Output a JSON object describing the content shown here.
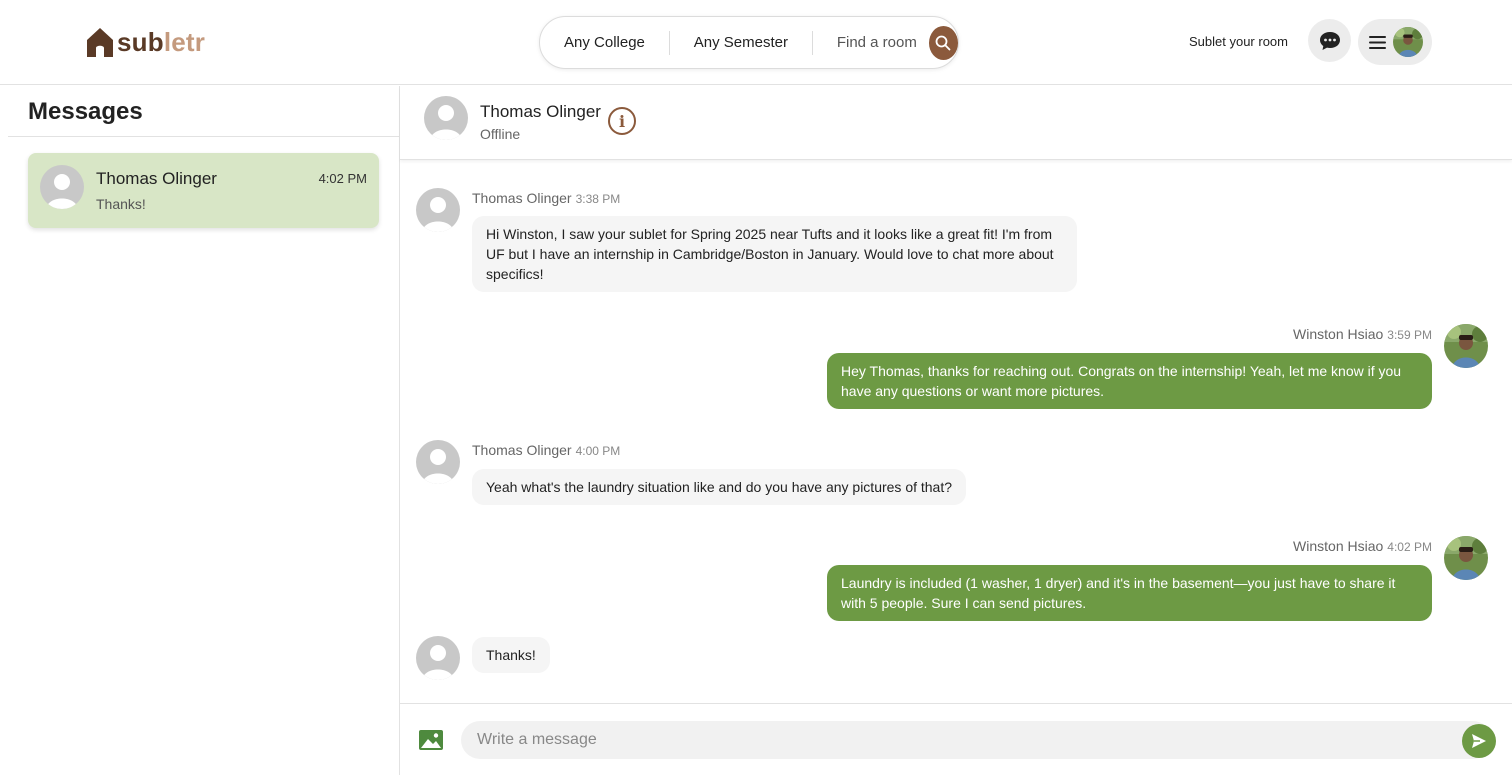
{
  "header": {
    "logo_sub": "sub",
    "logo_letr": "letr",
    "search": {
      "college": "Any College",
      "semester": "Any Semester",
      "find": "Find a room"
    },
    "sublet_link": "Sublet your room"
  },
  "sidebar": {
    "title": "Messages",
    "conversations": [
      {
        "name": "Thomas Olinger",
        "time": "4:02 PM",
        "preview": "Thanks!"
      }
    ]
  },
  "chat": {
    "contact_name": "Thomas Olinger",
    "contact_status": "Offline",
    "messages": [
      {
        "sender": "Thomas Olinger",
        "time": "3:38 PM",
        "direction": "in",
        "text": "Hi Winston, I saw your sublet for Spring 2025 near Tufts and it looks like a great fit! I'm from UF but I have an internship in Cambridge/Boston in January. Would love to chat more about specifics!"
      },
      {
        "sender": "Winston Hsiao",
        "time": "3:59 PM",
        "direction": "out",
        "text": "Hey Thomas, thanks for reaching out. Congrats on the internship! Yeah, let me know if you have any questions or want more pictures."
      },
      {
        "sender": "Thomas Olinger",
        "time": "4:00 PM",
        "direction": "in",
        "text": "Yeah what's the laundry situation like and do you have any pictures of that?"
      },
      {
        "sender": "Winston Hsiao",
        "time": "4:02 PM",
        "direction": "out",
        "text": "Laundry is included (1 washer, 1 dryer) and it's in the basement—you just have to share it with 5 people. Sure I can send pictures."
      },
      {
        "sender": "",
        "time": "",
        "direction": "in",
        "text": "Thanks!"
      }
    ],
    "composer_placeholder": "Write a message"
  },
  "colors": {
    "brand_brown": "#8b5a3c",
    "outgoing_bubble": "#6d9a44",
    "selected_convo": "#d8e6c6"
  },
  "icons": [
    "house-logo-icon",
    "search-icon",
    "chat-bubble-icon",
    "hamburger-menu-icon",
    "info-icon",
    "image-icon",
    "send-icon"
  ]
}
